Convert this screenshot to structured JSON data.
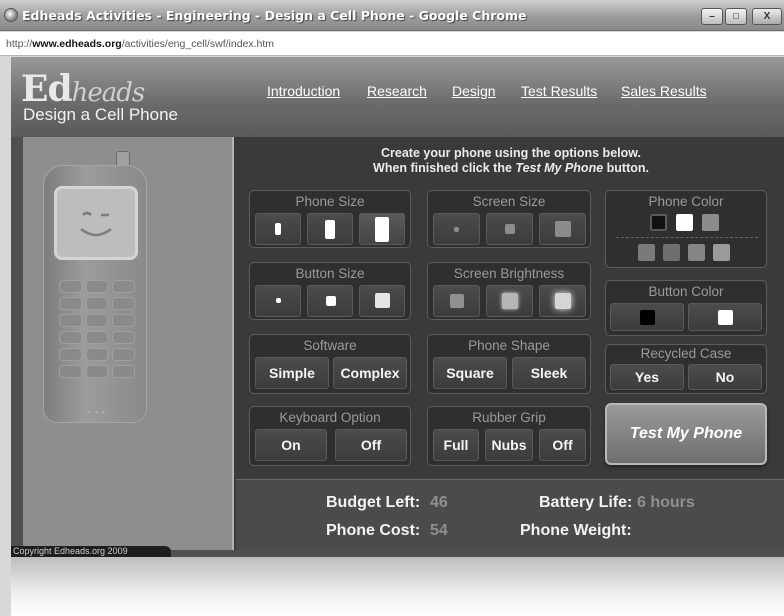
{
  "window": {
    "title": "Edheads Activities - Engineering - Design a Cell Phone - Google Chrome",
    "minimize_icon": "minimize-icon",
    "maximize_icon": "maximize-icon",
    "close_icon": "close-icon",
    "min_glyph": "–",
    "max_glyph": "□",
    "close_glyph": "X"
  },
  "address": {
    "prefix": "http://",
    "domain": "www.edheads.org",
    "path": "/activities/eng_cell/swf/index.htm"
  },
  "header": {
    "brand_ed": "Ed",
    "brand_heads": "heads",
    "subtitle": "Design a Cell Phone",
    "nav": [
      "Introduction",
      "Research",
      "Design",
      "Test Results",
      "Sales Results"
    ]
  },
  "instructions": {
    "line1": "Create your phone using the options below.",
    "line2_prefix": "When finished click the ",
    "line2_emph": "Test My Phone",
    "line2_suffix": " button."
  },
  "options": {
    "phone_size": {
      "title": "Phone Size"
    },
    "screen_size": {
      "title": "Screen Size"
    },
    "phone_color": {
      "title": "Phone Color"
    },
    "button_size": {
      "title": "Button Size"
    },
    "screen_brightness": {
      "title": "Screen Brightness"
    },
    "button_color": {
      "title": "Button Color"
    },
    "software": {
      "title": "Software",
      "choices": [
        "Simple",
        "Complex"
      ]
    },
    "phone_shape": {
      "title": "Phone Shape",
      "choices": [
        "Square",
        "Sleek"
      ]
    },
    "recycled_case": {
      "title": "Recycled Case",
      "choices": [
        "Yes",
        "No"
      ]
    },
    "keyboard_option": {
      "title": "Keyboard Option",
      "choices": [
        "On",
        "Off"
      ]
    },
    "rubber_grip": {
      "title": "Rubber Grip",
      "choices": [
        "Full",
        "Nubs",
        "Off"
      ]
    }
  },
  "test_button": "Test My Phone",
  "stats": {
    "budget_label": "Budget Left:",
    "budget_value": "46",
    "battery_label": "Battery Life:",
    "battery_value": "6 hours",
    "cost_label": "Phone Cost:",
    "cost_value": "54",
    "weight_label": "Phone Weight:",
    "weight_value": ""
  },
  "copyright": "Copyright Edheads.org 2009",
  "colors": {
    "swatch_black": "#111111",
    "swatch_white": "#ffffff",
    "swatch_gray": "#8c8c8c"
  }
}
